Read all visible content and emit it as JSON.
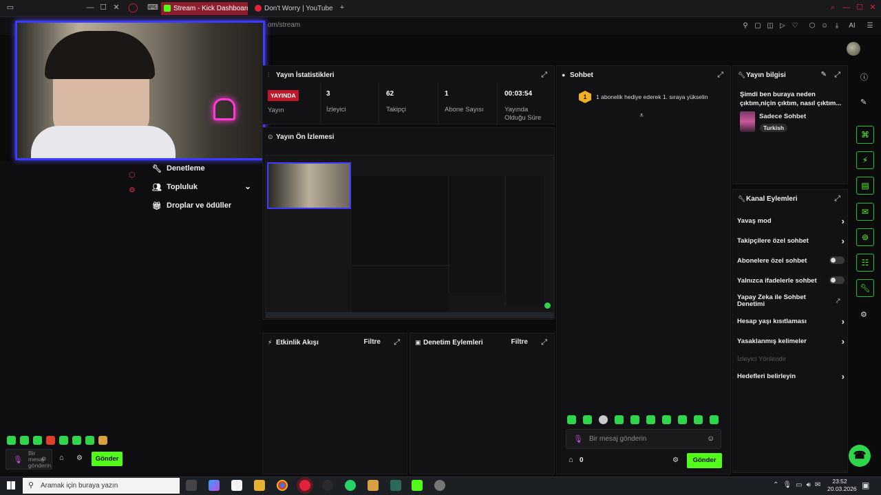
{
  "browser": {
    "tabs": [
      {
        "label": "Stream - Kick Dashboard",
        "active": true
      },
      {
        "label": "Don't Worry | YouTube",
        "active": false
      }
    ],
    "url": "om/stream",
    "ai_label": "AI"
  },
  "left_nav": {
    "items": [
      {
        "label": "Denetleme",
        "icon": "wrench-icon"
      },
      {
        "label": "Topluluk",
        "icon": "people-icon"
      },
      {
        "label": "Droplar ve ödüller",
        "icon": "gift-icon"
      }
    ]
  },
  "left_chat": {
    "placeholder_line1": "Bir",
    "placeholder_line2": "mesaj",
    "placeholder_line3": "gönderin",
    "send_label": "Gönder"
  },
  "stream_stats": {
    "title": "Yayın İstatistikleri",
    "live_badge": "YAYINDA",
    "live_label": "Yayın",
    "viewers_value": "3",
    "viewers_label": "İzleyici",
    "followers_value": "62",
    "followers_label": "Takipçi",
    "subs_value": "1",
    "subs_label": "Abone Sayısı",
    "uptime_value": "00:03:54",
    "uptime_label_1": "Yayında",
    "uptime_label_2": "Olduğu Süre"
  },
  "preview": {
    "title": "Yayın Ön İzlemesi"
  },
  "activity": {
    "title": "Etkinlik Akışı",
    "filter": "Filtre"
  },
  "moderation": {
    "title": "Denetim Eylemleri",
    "filter": "Filtre"
  },
  "chat": {
    "title": "Sohbet",
    "gift_badge": "1",
    "gift_message": "1 abonelik hediye ederek 1. sıraya yükselin",
    "input_placeholder": "Bir mesaj gönderin",
    "store_count": "0",
    "send_label": "Gönder"
  },
  "stream_info": {
    "title": "Yayın bilgisi",
    "stream_title": "Şimdi ben buraya neden çıktım,niçin çıktım, nasıl çıktım...",
    "category": "Sadece Sohbet",
    "language_tag": "Turkish"
  },
  "channel_actions": {
    "title": "Kanal Eylemleri",
    "rows": [
      {
        "label": "Yavaş mod",
        "control": "chevron"
      },
      {
        "label": "Takipçilere özel sohbet",
        "control": "chevron"
      },
      {
        "label": "Abonelere özel sohbet",
        "control": "toggle"
      },
      {
        "label": "Yalnızca ifadelerle sohbet",
        "control": "toggle"
      },
      {
        "label": "Yapay Zeka ile Sohbet Denetimi",
        "control": "external"
      },
      {
        "label": "Hesap yaşı kısıtlaması",
        "control": "chevron"
      },
      {
        "label": "Yasaklanmış kelimeler",
        "control": "chevron"
      },
      {
        "label": "İzleyici Yönlendir",
        "control": "disabled"
      },
      {
        "label": "Hedefleri belirleyin",
        "control": "chevron"
      }
    ]
  },
  "taskbar": {
    "search_placeholder": "Aramak için buraya yazın",
    "time": "23:52",
    "date": "20.03.2026"
  },
  "colors": {
    "accent": "#53fc18",
    "live": "#c0162a",
    "cam_border": "#3b3cff",
    "active_tab": "#8e1e2e"
  }
}
